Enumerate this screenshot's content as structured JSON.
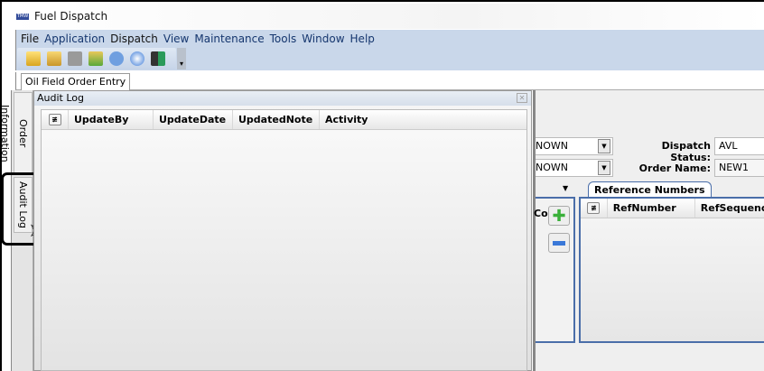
{
  "window": {
    "title": "Fuel Dispatch",
    "logo": "TMW"
  },
  "menu": [
    "File",
    "Application",
    "Dispatch",
    "View",
    "Maintenance",
    "Tools",
    "Window",
    "Help"
  ],
  "toolbar": {
    "icons": [
      "new-folder-icon",
      "open-folder-icon",
      "save-icon",
      "upload-icon",
      "message-icon",
      "help-icon",
      "exit-icon"
    ]
  },
  "document_tab": "Oil Field Order Entry",
  "side_tabs": [
    "Order Information",
    "Audit Log"
  ],
  "audit_log": {
    "title": "Audit Log",
    "columns": [
      "UpdateBy",
      "UpdateDate",
      "UpdatedNote",
      "Activity"
    ]
  },
  "form": {
    "combo1": "NOWN",
    "combo2": "NOWN",
    "dispatch_status_label": "Dispatch Status:",
    "dispatch_status": "AVL",
    "order_name_label": "Order Name:",
    "order_name": "NEW1",
    "left_column_partial": "Co"
  },
  "reference_numbers": {
    "tab": "Reference Numbers",
    "columns": [
      "RefNumber",
      "RefSequence"
    ]
  }
}
